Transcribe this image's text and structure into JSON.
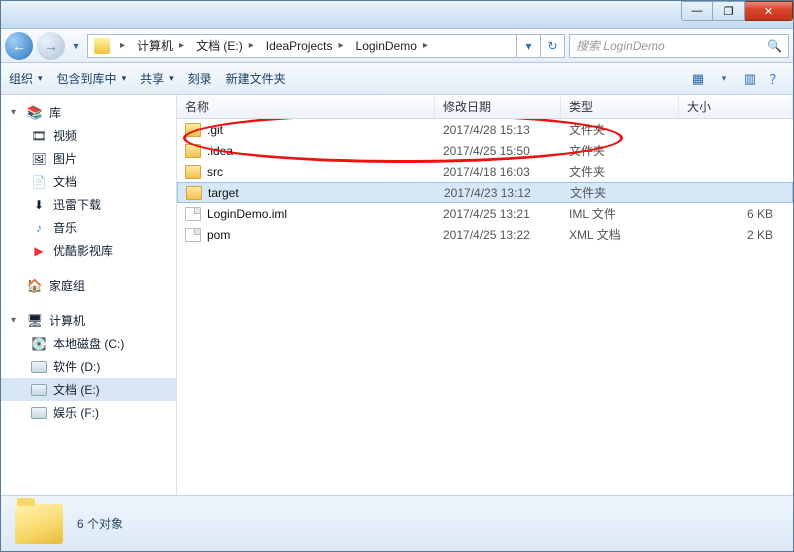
{
  "titlebar": {
    "min": "—",
    "max": "❐",
    "close": "✕"
  },
  "nav": {
    "back": "←",
    "forward": "→",
    "history": "▼",
    "refresh": "↻",
    "crumbs": [
      "计算机",
      "文档 (E:)",
      "IdeaProjects",
      "LoginDemo"
    ],
    "crumb_sep": "▸"
  },
  "search": {
    "placeholder": "搜索 LoginDemo",
    "icon": "🔍"
  },
  "toolbar": {
    "organize": "组织",
    "include": "包含到库中",
    "share": "共享",
    "burn": "刻录",
    "newfolder": "新建文件夹",
    "view_icon": "▦",
    "view_drop": "▾",
    "help_icon": "？"
  },
  "columns": {
    "name": "名称",
    "date": "修改日期",
    "type": "类型",
    "size": "大小"
  },
  "files": [
    {
      "name": ".git",
      "date": "2017/4/28 15:13",
      "type": "文件夹",
      "size": ""
    },
    {
      "name": ".idea",
      "date": "2017/4/25 15:50",
      "type": "文件夹",
      "size": ""
    },
    {
      "name": "src",
      "date": "2017/4/18 16:03",
      "type": "文件夹",
      "size": ""
    },
    {
      "name": "target",
      "date": "2017/4/23 13:12",
      "type": "文件夹",
      "size": ""
    },
    {
      "name": "LoginDemo.iml",
      "date": "2017/4/25 13:21",
      "type": "IML 文件",
      "size": "6 KB"
    },
    {
      "name": "pom",
      "date": "2017/4/25 13:22",
      "type": "XML 文档",
      "size": "2 KB"
    }
  ],
  "sidebar": {
    "library": {
      "label": "库",
      "items": [
        "视频",
        "图片",
        "文档",
        "迅雷下载",
        "音乐",
        "优酷影视库"
      ]
    },
    "homegroup": {
      "label": "家庭组"
    },
    "computer": {
      "label": "计算机",
      "drives": [
        "本地磁盘 (C:)",
        "软件 (D:)",
        "文档 (E:)",
        "娱乐 (F:)"
      ]
    }
  },
  "status": {
    "count": "6 个对象"
  },
  "icons": {
    "lib": "📚",
    "video": "🎞",
    "pic": "🖼",
    "doc": "📄",
    "dl": "⬇",
    "music": "♪",
    "youku": "▶",
    "home": "🏠",
    "pc": "🖥",
    "drive_c": "💽"
  }
}
